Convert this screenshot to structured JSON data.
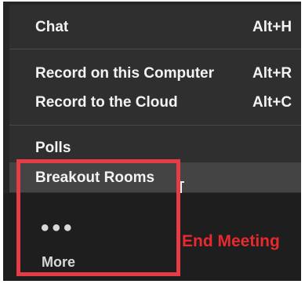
{
  "menu": {
    "items": [
      {
        "label": "Chat",
        "shortcut": "Alt+H"
      },
      {
        "label": "Record on this Computer",
        "shortcut": "Alt+R"
      },
      {
        "label": "Record to the Cloud",
        "shortcut": "Alt+C"
      },
      {
        "label": "Polls",
        "shortcut": ""
      },
      {
        "label": "Breakout Rooms",
        "shortcut": ""
      }
    ]
  },
  "toolbar": {
    "more_icon": "•••",
    "more_label": "More",
    "end_meeting_label": "End Meeting"
  },
  "colors": {
    "menu_background": "#2f2f2f",
    "hover_background": "#444444",
    "end_meeting": "#e8292f",
    "highlight_box": "#e63c48"
  }
}
